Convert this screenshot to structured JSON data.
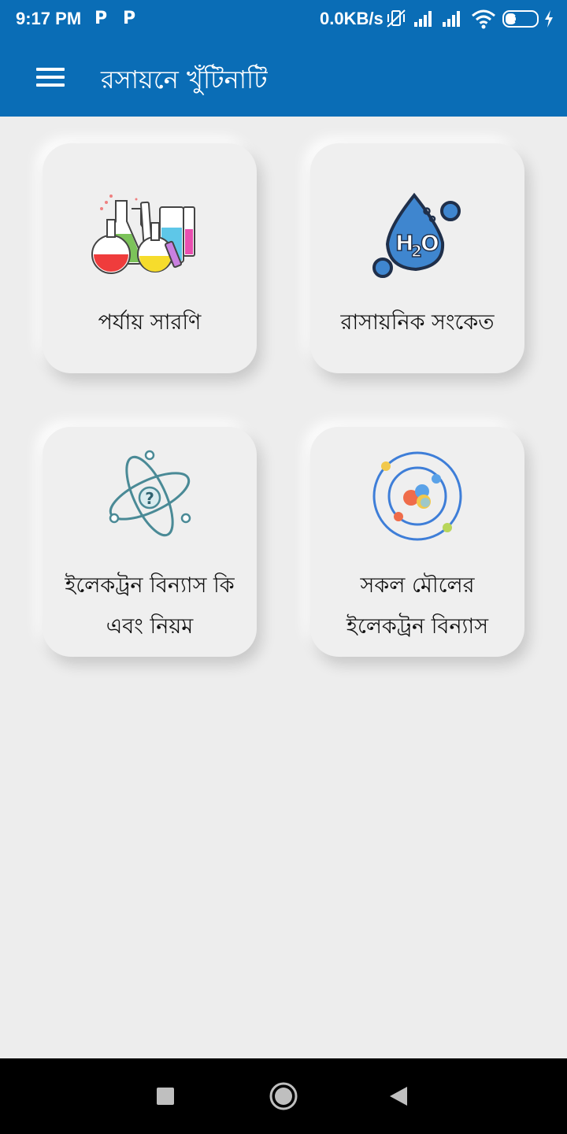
{
  "status_bar": {
    "time": "9:17 PM",
    "notification_icon_1": "P",
    "notification_icon_2": "P",
    "network_speed": "0.0KB/s",
    "battery_level": "35",
    "battery_fraction": 0.35,
    "icons": [
      "vibrate-off-icon",
      "signal-icon",
      "signal-icon",
      "wifi-icon",
      "battery-icon",
      "charging-icon"
    ]
  },
  "app_bar": {
    "title": "রসায়নে খুঁটিনাটি",
    "menu_icon": "hamburger-menu-icon"
  },
  "cards": [
    {
      "label": "পর্যায় সারণি",
      "icon": "lab-flasks-icon"
    },
    {
      "label": "রাসায়নিক সংকেত",
      "icon": "h2o-drop-icon"
    },
    {
      "label_line1": "ইলেকট্রন বিন্যাস কি",
      "label_line2": "এবং নিয়ম",
      "icon": "atom-question-icon"
    },
    {
      "label_line1": "সকল মৌলের",
      "label_line2": "ইলেকট্রন বিন্যাস",
      "icon": "atom-orbit-icon"
    }
  ],
  "nav_bar": {
    "recents": "recents-square-icon",
    "home": "home-circle-icon",
    "back": "back-triangle-icon"
  },
  "colors": {
    "primary": "#0a6db6",
    "background": "#ededed",
    "card": "#efefef"
  }
}
